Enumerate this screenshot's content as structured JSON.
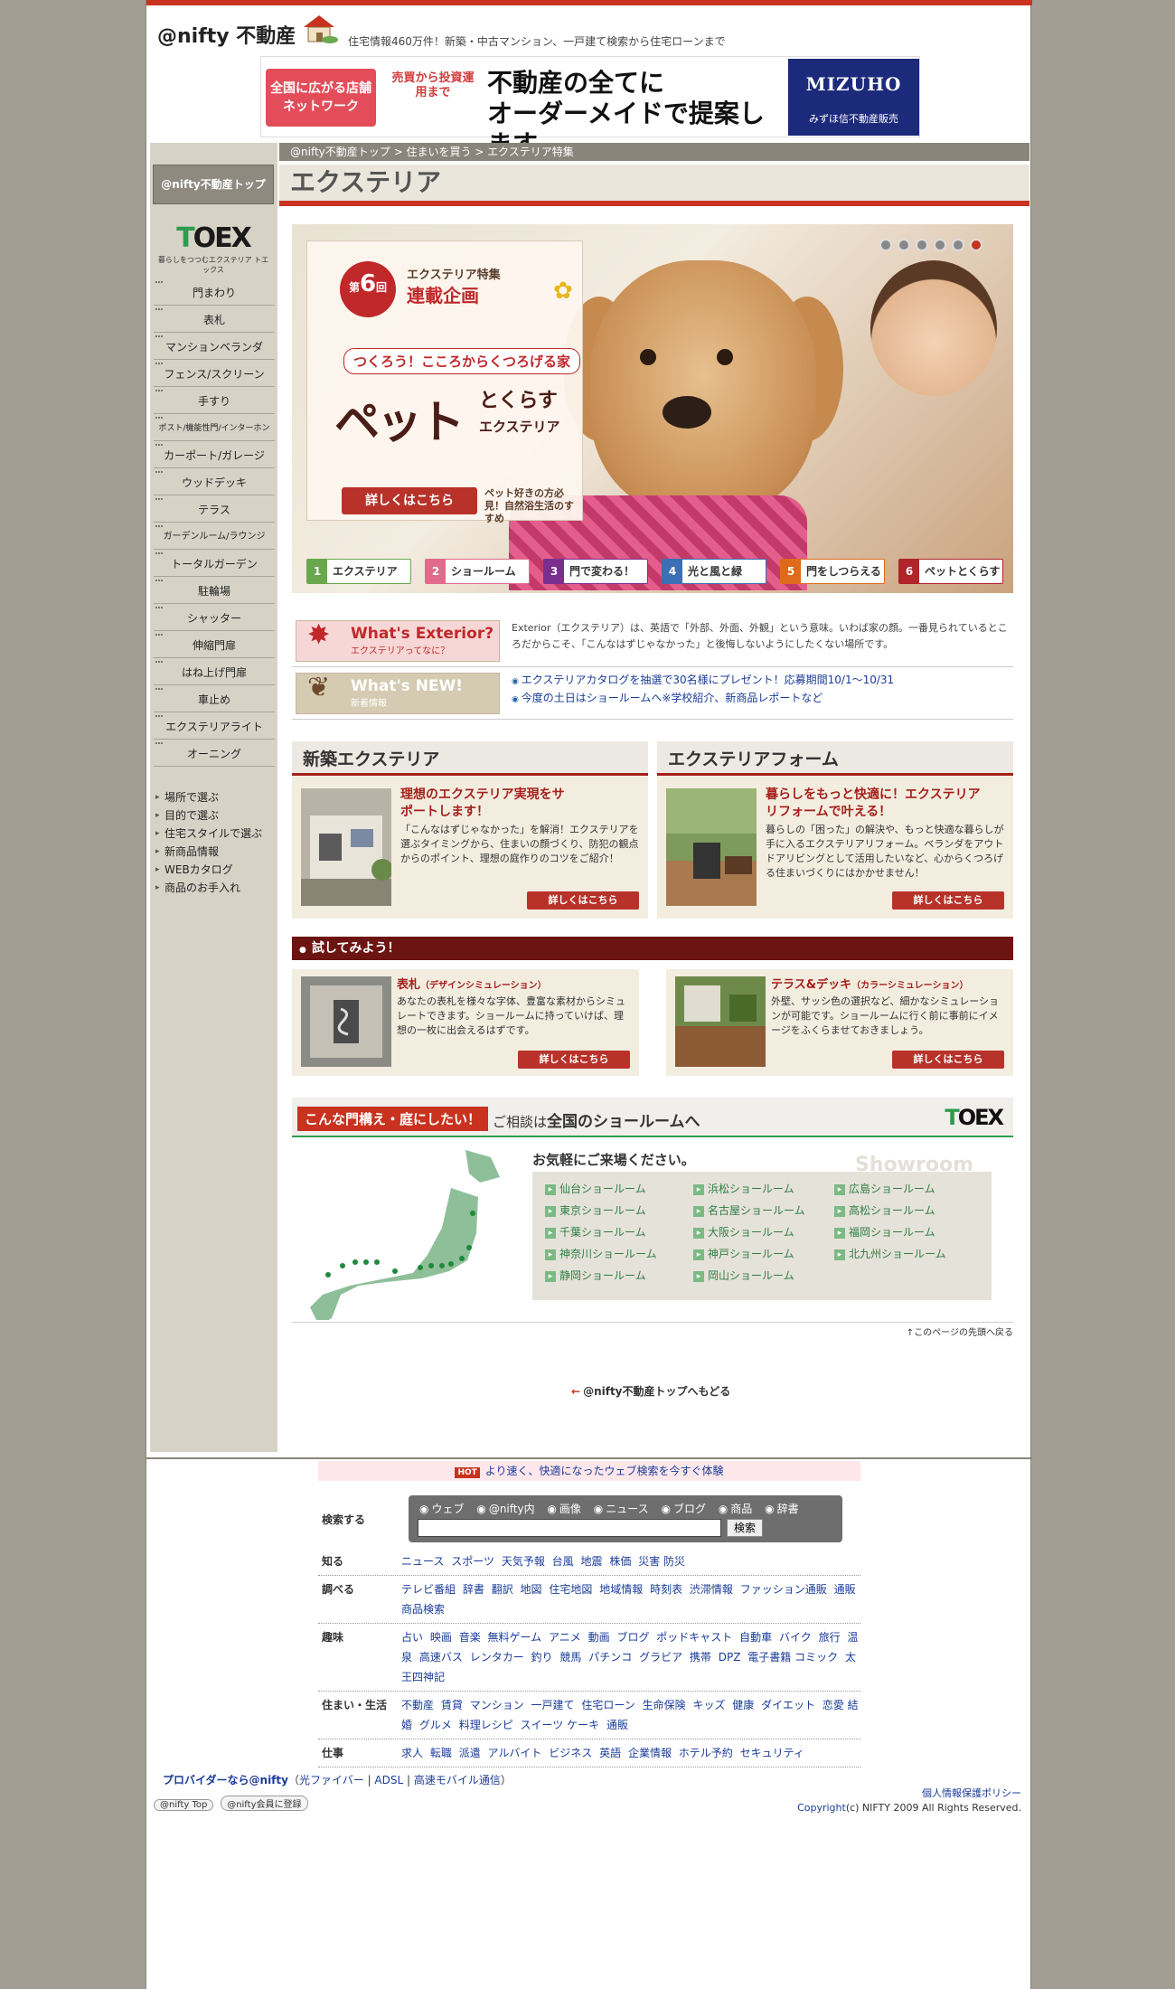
{
  "header": {
    "logo_text": "@nifty 不動産",
    "tagline": "住宅情報460万件！新築・中古マンション、一戸建て検索から住宅ローンまで"
  },
  "banner": {
    "left_text": "全国に広がる店舗ネットワーク",
    "sub_text": "売買から投資運用まで",
    "main_text": "不動産の全てにオーダーメイドで提案します。",
    "brand": "MIZUHO",
    "brand_sub": "みずほ信不動産販売"
  },
  "sidebar": {
    "top_button": "@nifty不動産トップ",
    "toex_logo": "TOEX",
    "toex_sub": "暮らしをつつむエクステリア トエックス",
    "menu": [
      "門まわり",
      "表札",
      "マンションベランダ",
      "フェンス/スクリーン",
      "手すり",
      "ポスト/機能性門/インターホン",
      "カーポート/ガレージ",
      "ウッドデッキ",
      "テラス",
      "ガーデンルーム/ラウンジ",
      "トータルガーデン",
      "駐輪場",
      "シャッター",
      "伸縮門扉",
      "はね上げ門扉",
      "車止め",
      "エクステリアライト",
      "オーニング"
    ],
    "links": [
      "場所で選ぶ",
      "目的で選ぶ",
      "住宅スタイルで選ぶ",
      "新商品情報",
      "WEBカタログ",
      "商品のお手入れ"
    ]
  },
  "breadcrumb": [
    "@nifty不動産トップ",
    "住まいを買う",
    "エクステリア特集"
  ],
  "page_title": "エクステリア",
  "hero": {
    "series_no": "6",
    "series_prefix": "第",
    "series_suffix": "回",
    "series_label": "エクステリア特集",
    "series_title": "連載企画",
    "subtitle": "つくろう！こころからくつろげる家",
    "main": "ペット",
    "main2": "とくらす",
    "main3": "エクステリア",
    "button": "詳しくはこちら",
    "note": "ペット好きの方必見！自然浴生活のすすめ",
    "tabs": [
      {
        "num": "1",
        "label": "エクステリア",
        "color": "#6aa84f"
      },
      {
        "num": "2",
        "label": "ショールーム",
        "color": "#e06b8b"
      },
      {
        "num": "3",
        "label": "門で変わる！",
        "color": "#7a2f8f"
      },
      {
        "num": "4",
        "label": "光と風と緑",
        "color": "#3c6fb4"
      },
      {
        "num": "5",
        "label": "門をしつらえる",
        "color": "#e06a1c"
      },
      {
        "num": "6",
        "label": "ペットとくらす",
        "color": "#b0242a"
      }
    ]
  },
  "info": {
    "exterior_tag": "What's Exterior?",
    "exterior_tag_sub": "エクステリアってなに？",
    "exterior_text": "Exterior（エクステリア）は、英語で「外部、外面、外観」という意味。いわば家の顔。一番見られているところだからこそ、「こんなはずじゃなかった」と後悔しないようにしたくない場所です。",
    "new_tag": "What's NEW!",
    "new_tag_sub": "新着情報",
    "news": [
      "エクステリアカタログを抽選で30名様にプレゼント！応募期間10/1〜10/31",
      "今度の土日はショールームへ※学校紹介、新商品レポートなど"
    ]
  },
  "cards": [
    {
      "header": "新築エクステリア",
      "title": "理想のエクステリア実現をサポートします！",
      "text": "「こんなはずじゃなかった」を解消！エクステリアを選ぶタイミングから、住まいの顔づくり、防犯の観点からのポイント、理想の庭作りのコツをご紹介！",
      "button": "詳しくはこちら"
    },
    {
      "header": "エクステリアフォーム",
      "title": "暮らしをもっと快適に！エクステリアリフォームで叶える！",
      "text": "暮らしの「困った」の解決や、もっと快適な暮らしが手に入るエクステリアリフォーム。ベランダをアウトドアリビングとして活用したいなど、心からくつろげる住まいづくりにはかかせません！",
      "button": "詳しくはこちら"
    }
  ],
  "try": {
    "header": "試してみよう！",
    "items": [
      {
        "title": "表札",
        "title_sub": "（デザインシミュレーション）",
        "text": "あなたの表札を様々な字体、豊富な素材からシミュレートできます。ショールームに持っていけば、理想の一枚に出会えるはずです。",
        "button": "詳しくはこちら"
      },
      {
        "title": "テラス&デッキ",
        "title_sub": "（カラーシミュレーション）",
        "text": "外壁、サッシ色の選択など、細かなシミュレーションが可能です。ショールームに行く前に事前にイメージをふくらませておきましょう。",
        "button": "詳しくはこちら"
      }
    ]
  },
  "showroom": {
    "badge": "こんな門構え・庭にしたい！",
    "lead": "ご相談は",
    "lead_bold": "全国のショールームへ",
    "logo": "TOEX",
    "title": "お気軽にご来場ください。",
    "bg_word": "Showroom",
    "cols": [
      [
        "仙台ショールーム",
        "東京ショールーム",
        "千葉ショールーム",
        "神奈川ショールーム",
        "静岡ショールーム"
      ],
      [
        "浜松ショールーム",
        "名古屋ショールーム",
        "大阪ショールーム",
        "神戸ショールーム",
        "岡山ショールーム"
      ],
      [
        "広島ショールーム",
        "高松ショールーム",
        "福岡ショールーム",
        "北九州ショールーム"
      ]
    ]
  },
  "pagetop": "このページの先頭へ戻る",
  "back_link": "@nifty不動産トップへもどる",
  "footer": {
    "hot_badge": "HOT",
    "hot_text": "より速く、快適になったウェブ検索を今すぐ体験",
    "search_label": "検索する",
    "search_options": [
      "ウェブ",
      "@nifty内",
      "画像",
      "ニュース",
      "ブログ",
      "商品",
      "辞書"
    ],
    "search_button": "検索",
    "directory": [
      {
        "label": "知る",
        "links": [
          "ニュース",
          "スポーツ",
          "天気予報",
          "台風",
          "地震",
          "株価",
          "災害 防災"
        ]
      },
      {
        "label": "調べる",
        "links": [
          "テレビ番組",
          "辞書",
          "翻訳",
          "地図",
          "住宅地図",
          "地域情報",
          "時刻表",
          "渋滞情報",
          "ファッション通販",
          "通販商品検索"
        ]
      },
      {
        "label": "趣味",
        "links": [
          "占い",
          "映画",
          "音楽",
          "無料ゲーム",
          "アニメ",
          "動画",
          "ブログ",
          "ポッドキャスト",
          "自動車",
          "バイク",
          "旅行",
          "温泉",
          "高速バス",
          "レンタカー",
          "釣り",
          "競馬",
          "パチンコ",
          "グラビア",
          "携帯",
          "DPZ",
          "電子書籍 コミック",
          "太王四神記"
        ]
      },
      {
        "label": "住まい・生活",
        "links": [
          "不動産",
          "賃貸",
          "マンション",
          "一戸建て",
          "住宅ローン",
          "生命保険",
          "キッズ",
          "健康",
          "ダイエット",
          "恋愛 結婚",
          "グルメ",
          "料理レシピ",
          "スイーツ ケーキ",
          "通販"
        ]
      },
      {
        "label": "仕事",
        "links": [
          "求人",
          "転職",
          "派遣",
          "アルバイト",
          "ビジネス",
          "英語",
          "企業情報",
          "ホテル予約",
          "セキュリティ"
        ]
      }
    ],
    "provider": "プロバイダーなら@nifty",
    "provider_links": [
      "光ファイバー",
      "ADSL",
      "高速モバイル通信"
    ],
    "badges": [
      "@nifty Top",
      "@nifty会員に登録"
    ],
    "privacy": "個人情報保護ポリシー",
    "copyright": "(c) NIFTY 2009 All Rights Reserved.",
    "copyright_link": "Copyright"
  }
}
